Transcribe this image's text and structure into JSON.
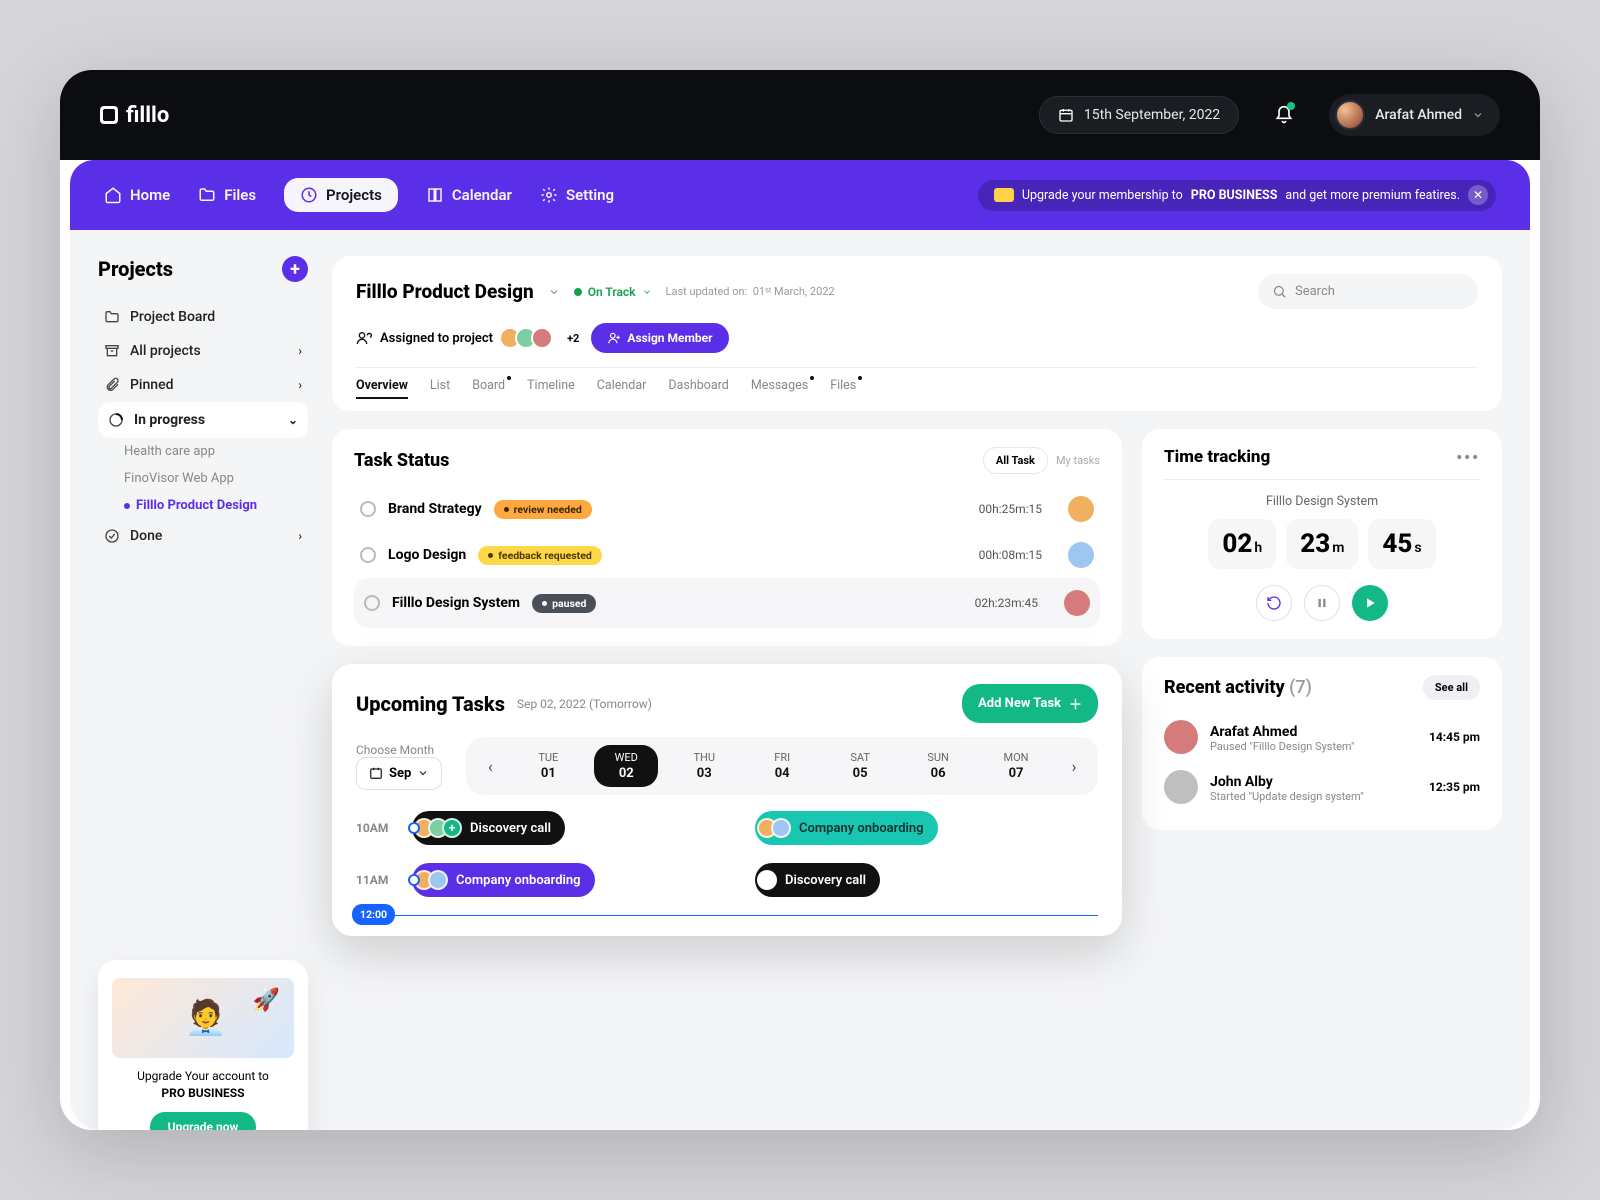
{
  "brand": "filllo",
  "header": {
    "date": "15th September, 2022",
    "user": "Arafat Ahmed"
  },
  "nav": {
    "items": [
      "Home",
      "Files",
      "Projects",
      "Calendar",
      "Setting"
    ],
    "banner_pre": "Upgrade your membership to ",
    "banner_bold": "PRO BUSINESS",
    "banner_post": " and get more premium featires."
  },
  "sidebar": {
    "title": "Projects",
    "rows": {
      "board": "Project Board",
      "all": "All projects",
      "pinned": "Pinned",
      "inprogress": "In progress",
      "done": "Done"
    },
    "subs": [
      "Health care app",
      "FinoVisor Web App",
      "Filllo Product Design"
    ],
    "upgrade_text_pre": "Upgrade Your account to",
    "upgrade_text_bold": "PRO BUSINESS",
    "upgrade_btn": "Upgrade now"
  },
  "project": {
    "title": "Filllo Product Design",
    "status": "On Track",
    "updated_label": "Last updated on:",
    "updated_value": "01ˢᵗ March, 2022",
    "assigned_label": "Assigned to project",
    "plus_count": "+2",
    "assign_btn": "Assign Member",
    "search_placeholder": "Search",
    "tabs": [
      "Overview",
      "List",
      "Board",
      "Timeline",
      "Calendar",
      "Dashboard",
      "Messages",
      "Files"
    ]
  },
  "task_status": {
    "title": "Task Status",
    "filter_active": "All Task",
    "filter_muted": "My tasks",
    "rows": [
      {
        "name": "Brand Strategy",
        "tag": "review needed",
        "tag_style": "orange",
        "dur": "00h:25m:15"
      },
      {
        "name": "Logo Design",
        "tag": "feedback requested",
        "tag_style": "yellow",
        "dur": "00h:08m:15"
      },
      {
        "name": "Filllo Design System",
        "tag": "paused",
        "tag_style": "grey",
        "dur": "02h:23m:45"
      }
    ]
  },
  "time_tracking": {
    "title": "Time tracking",
    "task": "Filllo Design System",
    "h": "02",
    "m": "23",
    "s": "45"
  },
  "upcoming": {
    "title": "Upcoming Tasks",
    "subtitle": "Sep 02, 2022 (Tomorrow)",
    "add_btn": "Add New Task",
    "choose_label": "Choose Month",
    "month": "Sep",
    "days": [
      {
        "d": "TUE",
        "n": "01"
      },
      {
        "d": "WED",
        "n": "02"
      },
      {
        "d": "THU",
        "n": "03"
      },
      {
        "d": "FRI",
        "n": "04"
      },
      {
        "d": "SAT",
        "n": "05"
      },
      {
        "d": "SUN",
        "n": "06"
      },
      {
        "d": "MON",
        "n": "07"
      }
    ],
    "time1": "10AM",
    "time2": "11AM",
    "now": "12:00",
    "ev_discovery": "Discovery call",
    "ev_company": "Company onboarding"
  },
  "recent": {
    "title": "Recent activity",
    "count": "(7)",
    "seeall": "See all",
    "items": [
      {
        "name": "Arafat Ahmed",
        "desc": "Paused \"Filllo Design System\"",
        "time": "14:45 pm"
      },
      {
        "name": "John Alby",
        "desc": "Started \"Update design system\"",
        "time": "12:35 pm"
      }
    ]
  }
}
